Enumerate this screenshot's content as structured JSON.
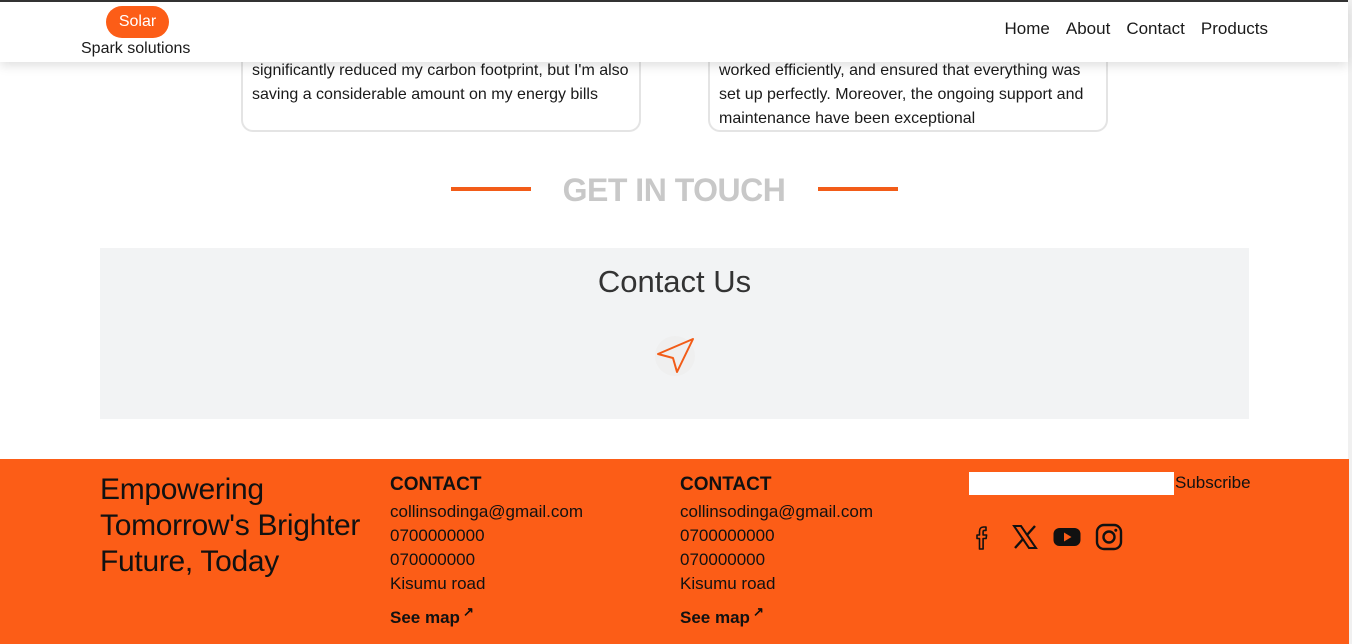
{
  "brand": {
    "pill": "Solar",
    "sub": "Spark solutions",
    "accent": "#fc5d17"
  },
  "nav": [
    "Home",
    "About",
    "Contact",
    "Products"
  ],
  "testimonials": [
    {
      "text": "significantly reduced my carbon footprint, but I'm also saving a considerable amount on my energy bills"
    },
    {
      "text": "worked efficiently, and ensured that everything was set up perfectly. Moreover, the ongoing support and maintenance have been exceptional"
    }
  ],
  "section": {
    "title": "GET IN TOUCH"
  },
  "contact": {
    "title": "Contact Us",
    "icon": "send-icon"
  },
  "footer": {
    "tagline": "Empowering Tomorrow's Brighter Future, Today",
    "columns": [
      {
        "heading": "CONTACT",
        "email": "collinsodinga@gmail.com",
        "phone1": "0700000000",
        "phone2": "070000000",
        "address": "Kisumu road",
        "map": "See map"
      },
      {
        "heading": "CONTACT",
        "email": "collinsodinga@gmail.com",
        "phone1": "0700000000",
        "phone2": "070000000",
        "address": "Kisumu road",
        "map": "See map"
      }
    ],
    "subscribe": {
      "button": "Subscribe",
      "placeholder": ""
    },
    "social": [
      "facebook-icon",
      "x-icon",
      "youtube-icon",
      "instagram-icon"
    ]
  }
}
